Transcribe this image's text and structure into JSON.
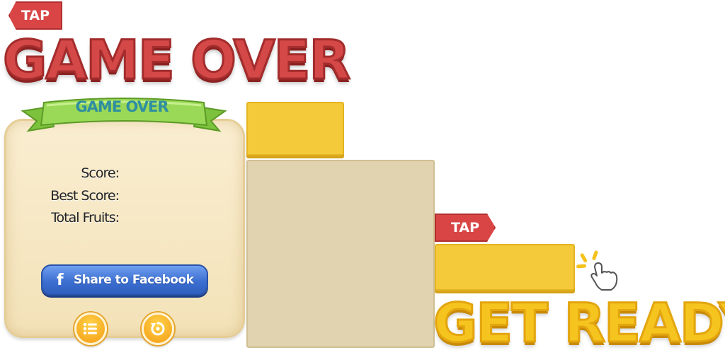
{
  "tags": {
    "top_tap": "TAP",
    "middle_tap": "TAP"
  },
  "titles": {
    "game_over": "GAME OVER",
    "get_ready": "GET READY"
  },
  "panel": {
    "ribbon_label": "GAME OVER",
    "stats": {
      "score_label": "Score:",
      "best_score_label": "Best Score:",
      "total_fruits_label": "Total Fruits:"
    },
    "facebook_button": {
      "icon": "f",
      "label": "Share to Facebook"
    },
    "buttons": {
      "menu_icon": "list-icon",
      "replay_icon": "replay-icon"
    }
  },
  "colors": {
    "tag_red": "#d94545",
    "title_red": "#d54848",
    "title_yellow": "#f6c41e",
    "ribbon_green": "#8bd14a",
    "facebook_blue": "#3d6fd0",
    "panel_beige": "#f6e8c6",
    "block_yellow": "#f4ca3a",
    "block_beige": "#e1d3af"
  }
}
